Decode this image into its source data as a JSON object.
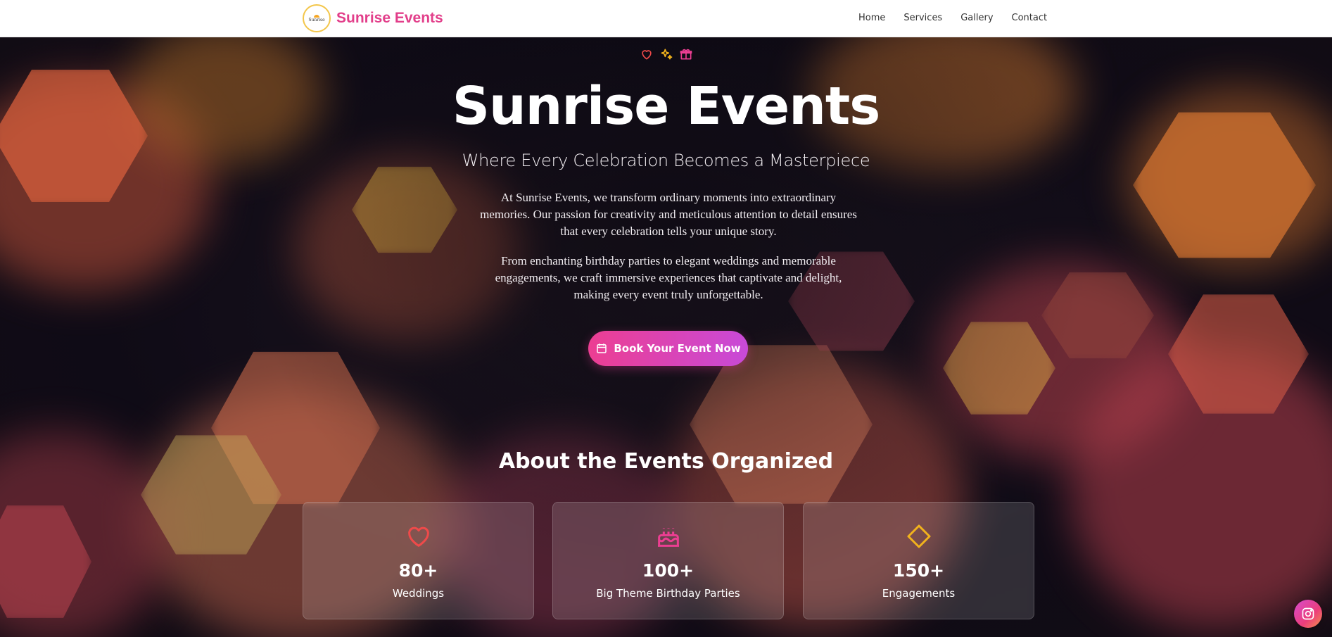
{
  "header": {
    "brand_name": "Sunrise Events",
    "logo_text": "Sunrise",
    "nav": [
      {
        "label": "Home"
      },
      {
        "label": "Services"
      },
      {
        "label": "Gallery"
      },
      {
        "label": "Contact"
      }
    ]
  },
  "hero": {
    "icons": [
      "heart-icon",
      "sparkles-icon",
      "gift-icon"
    ],
    "title": "Sunrise Events",
    "subtitle": "Where Every Celebration Becomes a Masterpiece",
    "paragraph_1": "At Sunrise Events, we transform ordinary moments into extraordinary memories. Our passion for creativity and meticulous attention to detail ensures that every celebration tells your unique story.",
    "paragraph_2": "From enchanting birthday parties to elegant weddings and memorable engagements, we craft immersive experiences that captivate and delight, making every event truly unforgettable.",
    "cta_label": "Book Your Event Now"
  },
  "stats": {
    "title": "About the Events Organized",
    "items": [
      {
        "icon": "heart-icon",
        "value": "80+",
        "label": "Weddings",
        "color": "#ef4a4a"
      },
      {
        "icon": "cake-icon",
        "value": "100+",
        "label": "Big Theme Birthday Parties",
        "color": "#ec3e92"
      },
      {
        "icon": "diamond-icon",
        "value": "150+",
        "label": "Engagements",
        "color": "#f2b31c"
      }
    ]
  },
  "social": {
    "icon": "instagram-icon"
  },
  "colors": {
    "brand": "#e23e8a",
    "cta_start": "#ec3e92",
    "cta_end": "#c84ad8"
  }
}
